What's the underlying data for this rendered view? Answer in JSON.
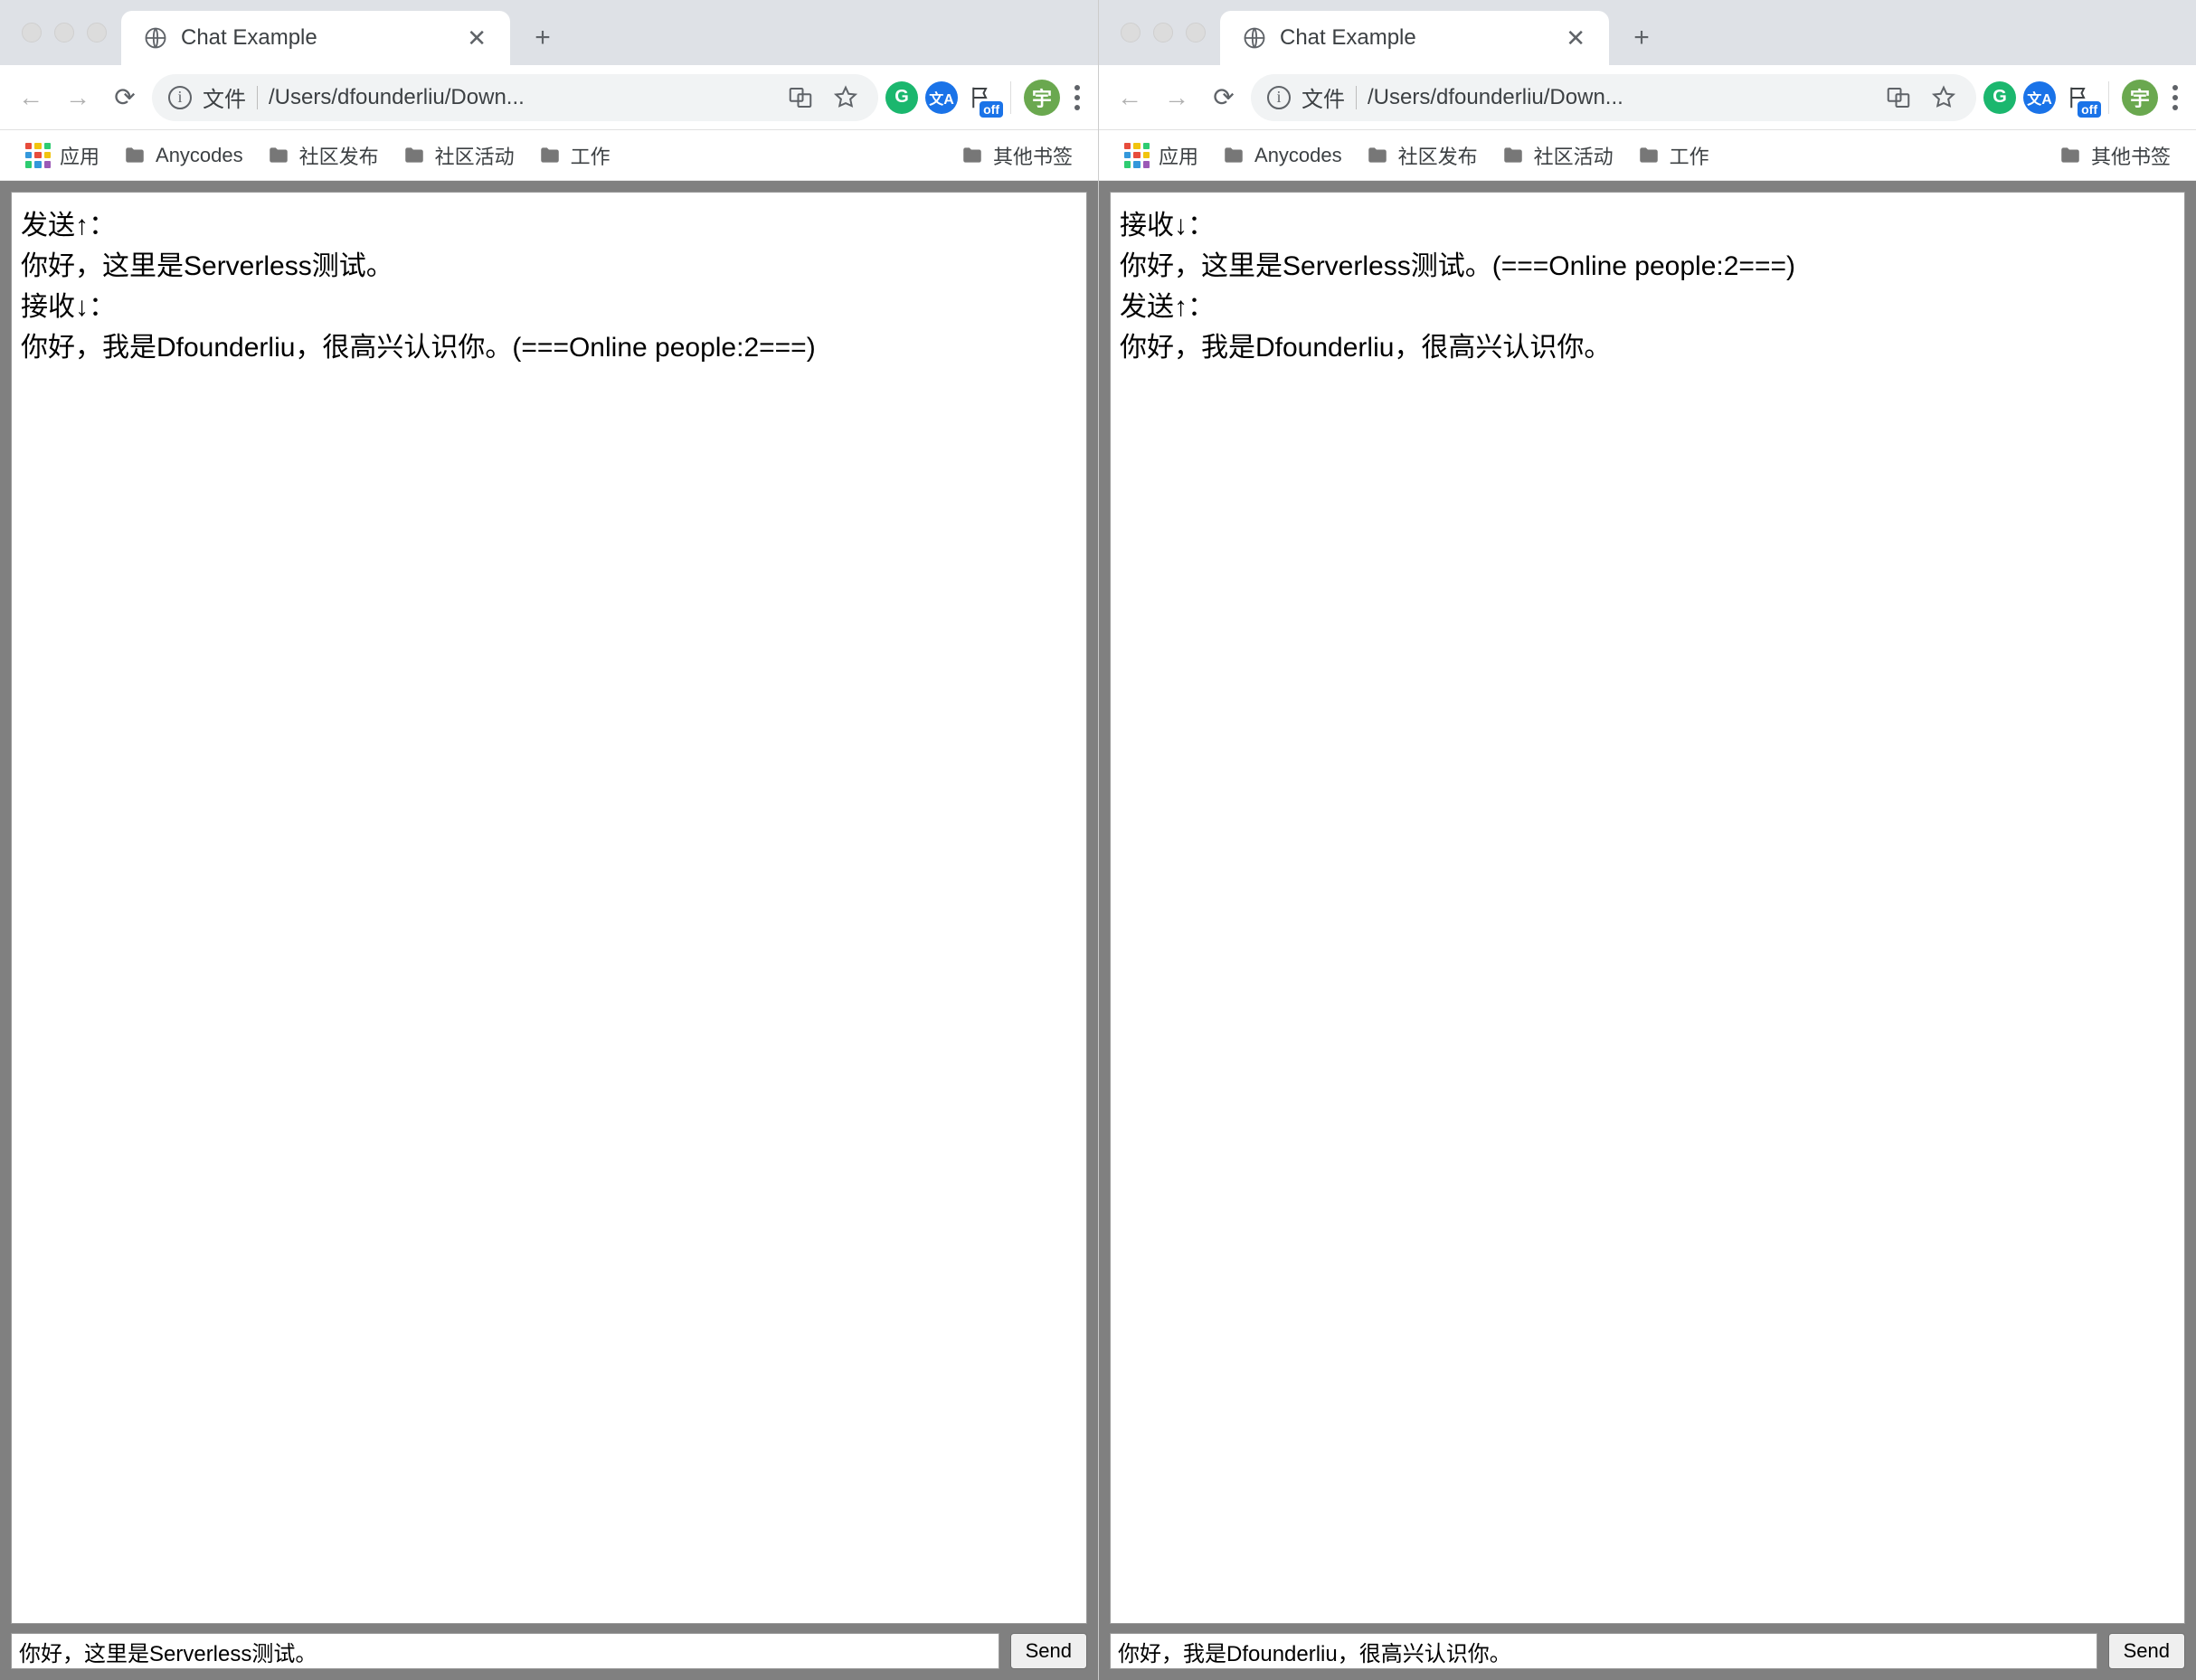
{
  "windows": [
    {
      "tab_title": "Chat Example",
      "omnibox_filetag": "文件",
      "omnibox_path": "/Users/dfounderliu/Down...",
      "avatar_letter": "宇",
      "bookmarks": {
        "apps_label": "应用",
        "items": [
          "Anycodes",
          "社区发布",
          "社区活动",
          "工作"
        ],
        "other_label": "其他书签"
      },
      "ext_badge": "off",
      "chat_lines": [
        "发送↑：",
        "你好，这里是Serverless测试。",
        "接收↓：",
        "你好，我是Dfounderliu，很高兴认识你。(===Online people:2===)"
      ],
      "input_value": "你好，这里是Serverless测试。",
      "send_label": "Send"
    },
    {
      "tab_title": "Chat Example",
      "omnibox_filetag": "文件",
      "omnibox_path": "/Users/dfounderliu/Down...",
      "avatar_letter": "宇",
      "bookmarks": {
        "apps_label": "应用",
        "items": [
          "Anycodes",
          "社区发布",
          "社区活动",
          "工作"
        ],
        "other_label": "其他书签"
      },
      "ext_badge": "off",
      "chat_lines": [
        "接收↓：",
        "你好，这里是Serverless测试。(===Online people:2===)",
        "发送↑：",
        "你好，我是Dfounderliu，很高兴认识你。"
      ],
      "input_value": "你好，我是Dfounderliu，很高兴认识你。",
      "send_label": "Send"
    }
  ]
}
